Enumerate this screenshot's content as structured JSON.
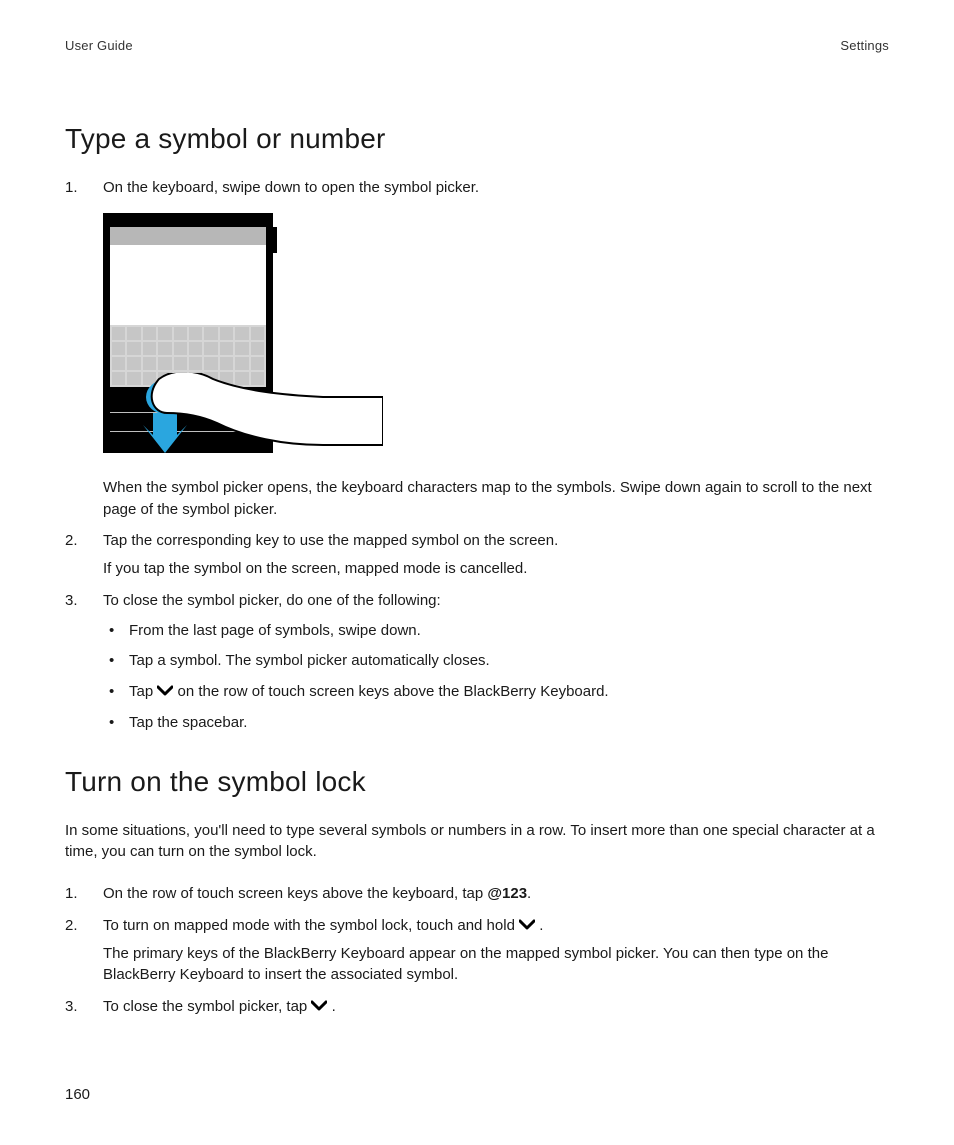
{
  "header": {
    "left": "User Guide",
    "right": "Settings"
  },
  "page_number": "160",
  "section1": {
    "title": "Type a symbol or number",
    "step1": "On the keyboard, swipe down to open the symbol picker.",
    "step1_after": "When the symbol picker opens, the keyboard characters map to the symbols. Swipe down again to scroll to the next page of the symbol picker.",
    "step2a": "Tap the corresponding key to use the mapped symbol on the screen.",
    "step2b": "If you tap the symbol on the screen, mapped mode is cancelled.",
    "step3": "To close the symbol picker, do one of the following:",
    "bullets": {
      "b1": "From the last page of symbols, swipe down.",
      "b2": "Tap a symbol. The symbol picker automatically closes.",
      "b3_pre": "Tap ",
      "b3_post": " on the row of touch screen keys above the BlackBerry Keyboard.",
      "b4": "Tap the spacebar."
    }
  },
  "section2": {
    "title": "Turn on the symbol lock",
    "intro": "In some situations, you'll need to type several symbols or numbers in a row. To insert more than one special character at a time, you can turn on the symbol lock.",
    "step1_pre": "On the row of touch screen keys above the keyboard, tap ",
    "step1_bold": "@123",
    "step1_post": ".",
    "step2a_pre": "To turn on mapped mode with the symbol lock, touch and hold ",
    "step2a_post": " .",
    "step2b": "The primary keys of the BlackBerry Keyboard appear on the mapped symbol picker. You can then type on the BlackBerry Keyboard to insert the associated symbol.",
    "step3_pre": "To close the symbol picker, tap ",
    "step3_post": " ."
  },
  "icons": {
    "chevron_down": "chevron-down-icon"
  }
}
